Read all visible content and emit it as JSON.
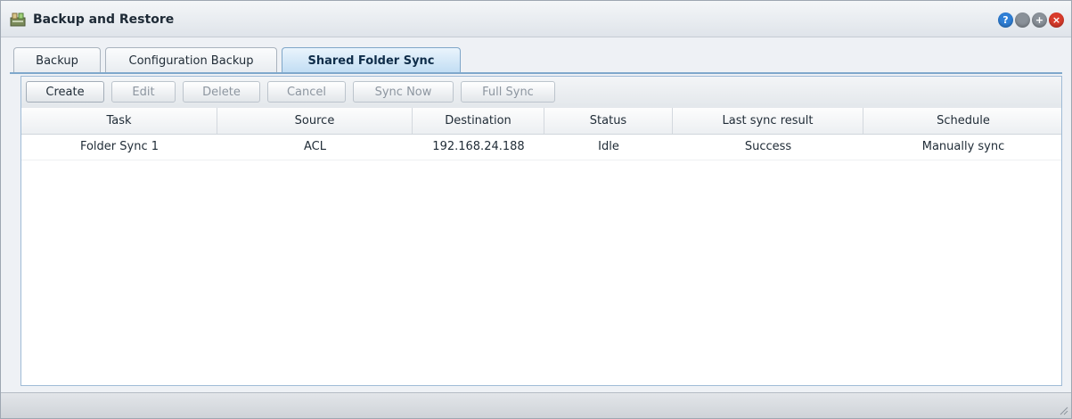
{
  "window": {
    "title": "Backup and Restore",
    "icon": "backup-restore-app-icon",
    "controls": [
      {
        "icon": "help-icon",
        "symbol": "?",
        "color": "#2f7fd6"
      },
      {
        "icon": "minimize-icon",
        "symbol": "",
        "color": "#8a9199"
      },
      {
        "icon": "maximize-icon",
        "symbol": "+",
        "color": "#8a9199"
      },
      {
        "icon": "close-icon",
        "symbol": "×",
        "color": "#d93b2b"
      }
    ]
  },
  "tabs": [
    {
      "label": "Backup",
      "active": false
    },
    {
      "label": "Configuration Backup",
      "active": false
    },
    {
      "label": "Shared Folder Sync",
      "active": true
    }
  ],
  "toolbar": {
    "create": "Create",
    "edit": "Edit",
    "delete": "Delete",
    "cancel": "Cancel",
    "sync_now": "Sync Now",
    "full_sync": "Full Sync"
  },
  "table": {
    "columns": [
      "Task",
      "Source",
      "Destination",
      "Status",
      "Last sync result",
      "Schedule"
    ],
    "rows": [
      [
        "Folder Sync 1",
        "ACL",
        "192.168.24.188",
        "Idle",
        "Success",
        "Manually sync"
      ]
    ]
  }
}
